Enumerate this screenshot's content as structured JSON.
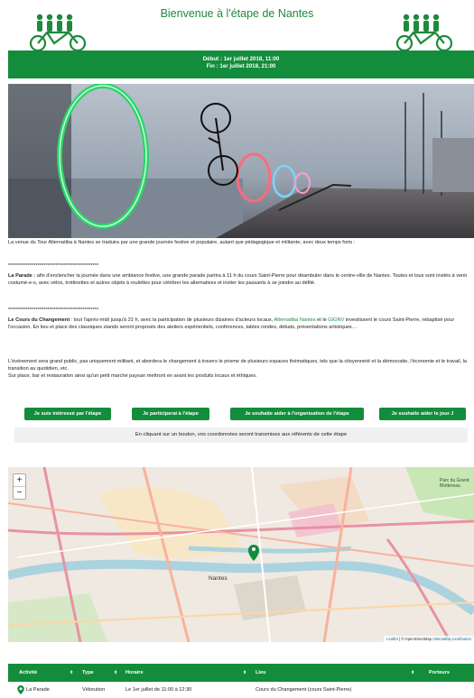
{
  "header": {
    "title": "Bienvenue à l'étape de Nantes"
  },
  "dates": {
    "start": "Début : 1er juillet 2018, 11:00",
    "end": "Fin : 1er juillet 2018, 21:00"
  },
  "intro": "La venue du Tour Alternatiba à Nantes se traduira par une grande journée festive et populaire, autant que pédagogique et militante, avec deux temps forts :",
  "separator": "**********************************************",
  "parade": {
    "label": "La Parade :",
    "text": "afin d'enclencher la journée dans une ambiance festive, une grande parade partira à 11 h du cours Saint-Pierre pour déambuler dans le centre-ville de Nantes. Toutes et tous sont invités à venir costumé-e-s, avec vélos, trottinettes et autres objets à roulettes pour célébrer les alternatives et inviter les passants à se joindre au défilé."
  },
  "cours": {
    "label": "Le Cours du Changement",
    "text1": ": tout l'après-midi jusqu'à 21 h, avec la participation de plusieurs dizaines d'acteurs locaux,",
    "link1": "Alternatiba Nantes",
    "text2": "et le",
    "link2": "GIGNV",
    "text3": "investissent le cours Saint-Pierre, rebaptisé pour l'occasion. En lieu et place des classiques stands seront proposés des ateliers expérientiels, conférences, tables rondes, débats, présentations artistiques…"
  },
  "outro1": "L'événement sera grand public, pas uniquement militant, et abordera le changement à travers le prisme de plusieurs espaces thématiques, tels que la citoyenneté et la démocratie, l'économie et le travail, la transition au quotidien, etc.",
  "outro2": "Sur place, bar et restauration ainsi qu'un petit marché paysan mettront en avant les produits locaux et éthiques.",
  "buttons": {
    "interested": "Je suis intéressé par l'étape",
    "participate": "Je participerai à l'étape",
    "help_org": "Je souhaite aider à l'organisation de l'étape",
    "help_day": "Je souhaite aider le jour J"
  },
  "notice": "En cliquant sur un bouton, vos coordonnées seront transmises aux référents de cette étape",
  "map": {
    "zoom_in": "+",
    "zoom_out": "−",
    "city_label": "Nantes",
    "park_label": "Parc du Grand Blottereau",
    "attribution_leaflet": "Leaflet",
    "attribution_sep": "|",
    "attribution_osm": "© OpenStreetMap",
    "attribution_alt": "Alternatiba contributors"
  },
  "table": {
    "headers": [
      "Activité",
      "Type",
      "Horaire",
      "Lieu",
      "Porteurs"
    ],
    "sort_glyph": "⬍",
    "rows": [
      [
        "La Parade",
        "Vélorution",
        "Le 1er juillet de 11:00 à 12:30",
        "Cours du Changement (cours Saint-Pierre)",
        ""
      ]
    ]
  },
  "colors": {
    "brand_green": "#138c3b",
    "title_green": "#1e8a3c"
  }
}
